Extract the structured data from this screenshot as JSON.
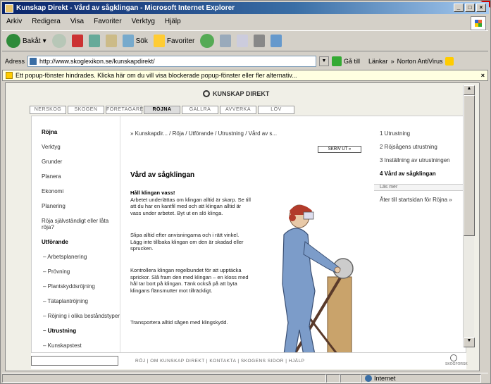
{
  "window": {
    "title": "Kunskap Direkt - Vård av sågklingan - Microsoft Internet Explorer",
    "controls": [
      "_",
      "□",
      "×"
    ]
  },
  "menu": [
    "Arkiv",
    "Redigera",
    "Visa",
    "Favoriter",
    "Verktyg",
    "Hjälp"
  ],
  "toolbar": {
    "back_label": "Bakåt",
    "search_label": "Sök",
    "favorites_label": "Favoriter"
  },
  "address": {
    "label": "Adress",
    "url": "http://www.skoglexikon.se/kunskapdirekt/",
    "go_label": "Gå till",
    "links_label": "Länkar",
    "norton_label": "Norton AntiVirus"
  },
  "infobar": {
    "text": "Ett popup-fönster hindrades. Klicka här om du vill visa blockerade popup-fönster eller fler alternativ..."
  },
  "site": {
    "logo_text": "KUNSKAP DIREKT",
    "tabs": [
      "NERSKOG",
      "SKOGEN",
      "FÖRETAGARE",
      "RÖJNA",
      "GALLRA",
      "AVVERKA",
      "LÖV"
    ],
    "active_tab_index": 3
  },
  "leftnav": [
    {
      "label": "Röjna",
      "bold": true
    },
    {
      "label": "Verktyg",
      "bold": false
    },
    {
      "label": "Grunder",
      "bold": false
    },
    {
      "label": "Planera",
      "bold": false
    },
    {
      "label": "Ekonomi",
      "bold": false
    },
    {
      "label": "Planering",
      "bold": false
    },
    {
      "label": "Röja självständigt eller låta röja?",
      "bold": false
    },
    {
      "label": "Utförande",
      "bold": true
    },
    {
      "label": "– Arbetsplanering",
      "bold": false
    },
    {
      "label": "– Prövning",
      "bold": false
    },
    {
      "label": "– Plantskyddsröjning",
      "bold": false
    },
    {
      "label": "– Tätaplantröjning",
      "bold": false
    },
    {
      "label": "– Röjning i olika beståndstyper",
      "bold": false
    },
    {
      "label": "– Utrustning",
      "bold": true
    },
    {
      "label": "– Kunskapstest",
      "bold": false
    }
  ],
  "main": {
    "breadcrumb": "» Kunskapdir... / Röja / Utförande / Utrustning / Vård av s...",
    "print_label": "SKRIV UT »",
    "heading": "Vård av sågklingan",
    "p1_title": "Håll klingan vass!",
    "p1": "Arbetet underlättas om klingan alltid är skarp. Se till att du har en kantfil med och att klingan alltid är vass under arbetet. Byt ut en slö klinga.",
    "p2": "Slipa alltid efter anvisningarna och i rätt vinkel. Lägg inte tillbaka klingan om den är skadad eller sprucken.",
    "p3": "Kontrollera klingan regelbundet för att upptäcka sprickor. Slå fram den med klingan – en kloss med hål tar bort på klingan. Tänk också på att byta klingans flänsmutter mot tillräckligt.",
    "p4": "Transportera alltid sågen med klingskydd."
  },
  "rightnav": [
    {
      "label": "1 Utrustning",
      "bold": false
    },
    {
      "label": "2 Röjsågens utrustning",
      "bold": false
    },
    {
      "label": "3 Inställning av utrustningen",
      "bold": false
    },
    {
      "label": "4 Vård av sågklingan",
      "bold": true
    }
  ],
  "rightnav_sep": "Läs mer",
  "rightnav_more": "Åter till startsidan för Röjna »",
  "footer": {
    "links": "RÖJ  |  OM KUNSKAP DIREKT  |  KONTAKTA  |  SKOGENS SIDOR  |  HJÄLP",
    "logo_text": "SKOGFORSK"
  },
  "status": {
    "zone_label": "Internet"
  }
}
